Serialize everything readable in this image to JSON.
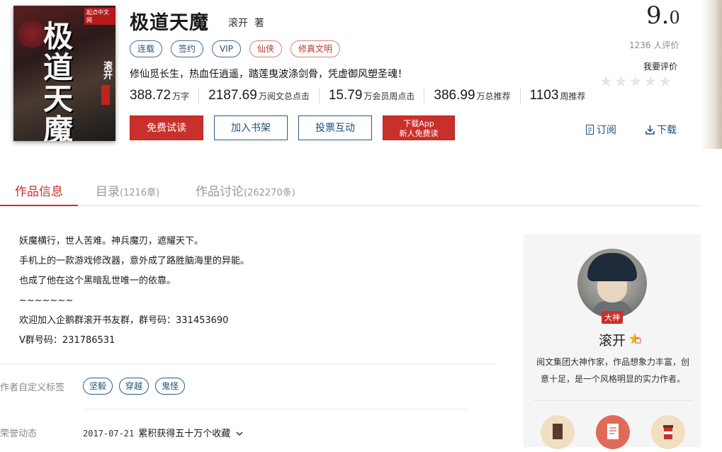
{
  "book": {
    "title": "极道天魔",
    "author": "滚开",
    "author_suffix": "著",
    "cover": {
      "brand": "起点中文网",
      "title_chars": "极道天魔",
      "author": "滚开"
    },
    "tags": [
      "连载",
      "签约",
      "VIP",
      "仙侠",
      "修真文明"
    ],
    "intro": "修仙觅长生，热血任逍遥，踏莲曳波涤剑骨，凭虚御风塑圣魂！",
    "stats": [
      {
        "value": "388.72",
        "unit": "万字"
      },
      {
        "value": "2187.69",
        "unit": "万阅文总点击"
      },
      {
        "value": "15.79",
        "unit": "万会员周点击"
      },
      {
        "value": "386.99",
        "unit": "万总推荐"
      },
      {
        "value": "1103",
        "unit": "周推荐"
      }
    ]
  },
  "actions": {
    "read": "免费试读",
    "shelf": "加入书架",
    "vote": "投票互动",
    "app_line1": "下载App",
    "app_line2": "新人免费读",
    "subscribe": "订阅",
    "download": "下载"
  },
  "rating": {
    "score_int": "9.",
    "score_dec": "0",
    "raters": "1236",
    "raters_suffix": "人评价",
    "my_rate": "我要评价"
  },
  "tabs": [
    {
      "label": "作品信息",
      "count": ""
    },
    {
      "label": "目录",
      "count": "(1216章)"
    },
    {
      "label": "作品讨论",
      "count": "(262270条)"
    }
  ],
  "description": [
    "妖魔横行，世人苦难。神兵魔刃，遮耀天下。",
    "手机上的一款游戏修改器，意外成了路胜脑海里的异能。",
    "也成了他在这个黑暗乱世唯一的依靠。",
    "~~~~~~~",
    "欢迎加入企鹅群滚开书友群，群号码：331453690",
    "V群号码：231786531"
  ],
  "custom_tags": {
    "label": "作者自定义标签",
    "items": [
      "坚毅",
      "穿越",
      "鬼怪"
    ]
  },
  "honor": {
    "label": "荣誉动态",
    "date": "2017-07-21",
    "text": "累积获得五十万个收藏"
  },
  "author_panel": {
    "badge": "大神",
    "name": "滚开",
    "desc": "阅文集团大神作家，作品想象力丰富，创意十足，是一个风格明显的实力作者。"
  },
  "colors": {
    "accent": "#c9302c",
    "link": "#1e4f78"
  }
}
